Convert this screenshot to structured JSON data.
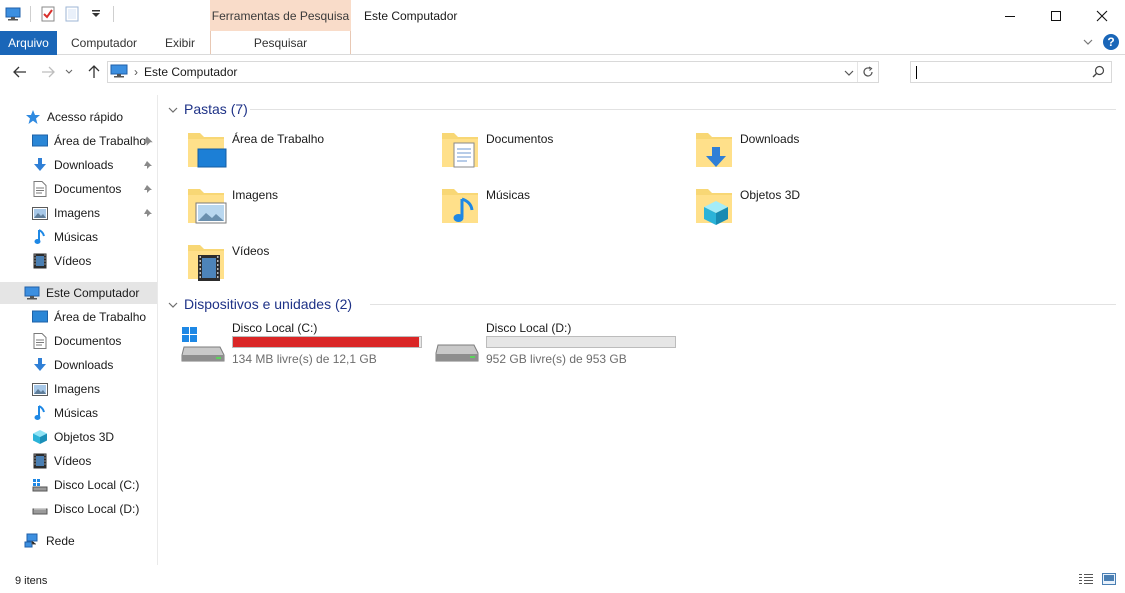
{
  "titlebar": {
    "context_tab_header": "Ferramentas de Pesquisa",
    "window_title": "Este Computador"
  },
  "ribbon": {
    "tabs": [
      "Arquivo",
      "Computador",
      "Exibir"
    ],
    "context_tab": "Pesquisar"
  },
  "address": {
    "crumb": "Este Computador",
    "search_placeholder": ""
  },
  "nav": {
    "quick_access": "Acesso rápido",
    "quick_items": [
      "Área de Trabalho",
      "Downloads",
      "Documentos",
      "Imagens",
      "Músicas",
      "Vídeos"
    ],
    "this_pc": "Este Computador",
    "pc_items": [
      "Área de Trabalho",
      "Documentos",
      "Downloads",
      "Imagens",
      "Músicas",
      "Objetos 3D",
      "Vídeos",
      "Disco Local (C:)",
      "Disco Local (D:)"
    ],
    "network": "Rede"
  },
  "content": {
    "folders_header": "Pastas (7)",
    "folders": [
      "Área de Trabalho",
      "Documentos",
      "Downloads",
      "Imagens",
      "Músicas",
      "Objetos 3D",
      "Vídeos"
    ],
    "devices_header": "Dispositivos e unidades (2)",
    "drives": [
      {
        "name": "Disco Local (C:)",
        "free": "134 MB livre(s) de 12,1 GB",
        "used_fraction": 0.99,
        "bar_color": "#da2626"
      },
      {
        "name": "Disco Local (D:)",
        "free": "952 GB livre(s) de 953 GB",
        "used_fraction": 0.0,
        "bar_color": "#26a0da"
      }
    ]
  },
  "status": {
    "item_count": "9 itens"
  },
  "colors": {
    "accent": "#1a66b8",
    "context_tab": "#f9dcc9",
    "group_header": "#1e3287",
    "folder": "#f8d775"
  }
}
